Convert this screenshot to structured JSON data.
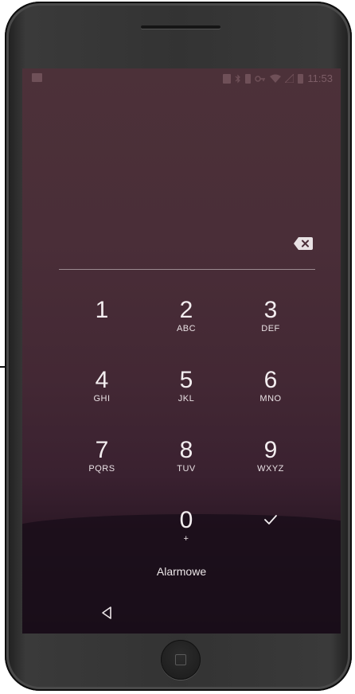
{
  "status_bar": {
    "time": "11:53",
    "icons": [
      "notification-icon",
      "nfc-icon",
      "bluetooth-icon",
      "vibrate-icon",
      "vpn-key-icon",
      "wifi-icon",
      "no-signal-icon",
      "battery-icon"
    ]
  },
  "pin_entry": {
    "backspace_icon": "backspace-icon"
  },
  "keypad": {
    "keys": [
      {
        "digit": "1",
        "letters": ""
      },
      {
        "digit": "2",
        "letters": "ABC"
      },
      {
        "digit": "3",
        "letters": "DEF"
      },
      {
        "digit": "4",
        "letters": "GHI"
      },
      {
        "digit": "5",
        "letters": "JKL"
      },
      {
        "digit": "6",
        "letters": "MNO"
      },
      {
        "digit": "7",
        "letters": "PQRS"
      },
      {
        "digit": "8",
        "letters": "TUV"
      },
      {
        "digit": "9",
        "letters": "WXYZ"
      },
      {
        "digit": "0",
        "letters": "+"
      }
    ],
    "confirm_icon": "checkmark-icon"
  },
  "emergency_label": "Alarmowe",
  "navigation": {
    "back_icon": "back-triangle-icon",
    "home_icon": "home-button-icon"
  },
  "colors": {
    "wallpaper_top": "#4c3139",
    "wallpaper_bottom": "#180c18",
    "text": "#f3eef0",
    "divider": "#9c8a90"
  }
}
